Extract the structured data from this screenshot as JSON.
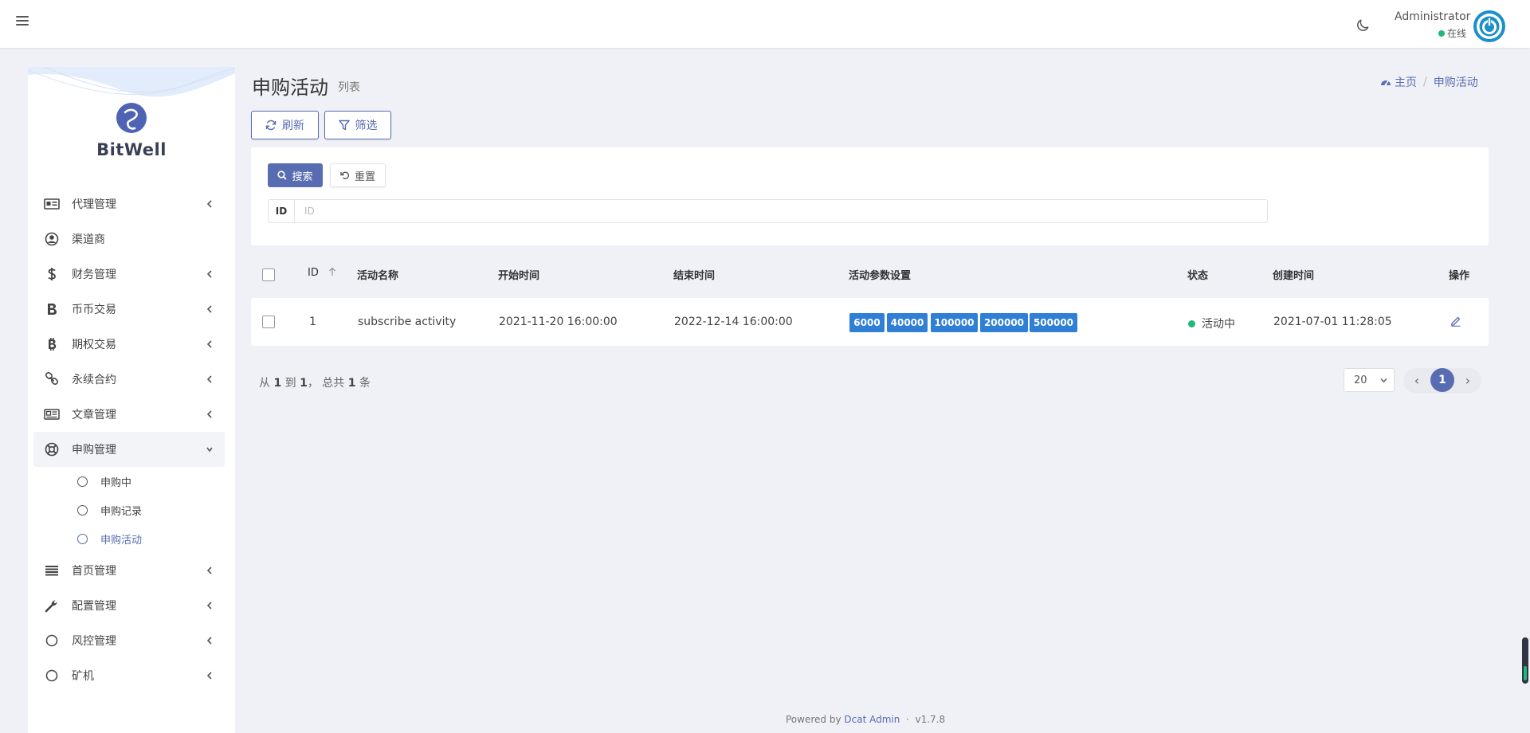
{
  "header": {
    "user_name": "Administrator",
    "user_status": "在线"
  },
  "sidebar": {
    "brand": "BitWell",
    "items": [
      {
        "label": "代理管理",
        "icon": "id-card-icon",
        "has_chevron": true
      },
      {
        "label": "渠道商",
        "icon": "user-circle-icon",
        "has_chevron": false
      },
      {
        "label": "财务管理",
        "icon": "dollar-icon",
        "has_chevron": true
      },
      {
        "label": "币币交易",
        "icon": "bold-b-icon",
        "has_chevron": true
      },
      {
        "label": "期权交易",
        "icon": "bitcoin-icon",
        "has_chevron": true
      },
      {
        "label": "永续合约",
        "icon": "link-icon",
        "has_chevron": true
      },
      {
        "label": "文章管理",
        "icon": "newspaper-icon",
        "has_chevron": true
      },
      {
        "label": "申购管理",
        "icon": "lifebuoy-icon",
        "has_chevron": true,
        "expanded": true
      },
      {
        "label": "首页管理",
        "icon": "list-icon",
        "has_chevron": true
      },
      {
        "label": "配置管理",
        "icon": "wrench-icon",
        "has_chevron": true
      },
      {
        "label": "风控管理",
        "icon": "circle-icon",
        "has_chevron": true
      },
      {
        "label": "矿机",
        "icon": "circle-icon",
        "has_chevron": true
      }
    ],
    "sub_items": [
      {
        "label": "申购中"
      },
      {
        "label": "申购记录"
      },
      {
        "label": "申购活动",
        "current": true
      }
    ]
  },
  "page": {
    "title": "申购活动",
    "subtitle": "列表",
    "breadcrumb": {
      "home": "主页",
      "current": "申购活动"
    }
  },
  "toolbar": {
    "refresh": "刷新",
    "filter": "筛选"
  },
  "filter": {
    "search": "搜索",
    "reset": "重置",
    "id_label": "ID",
    "id_placeholder": "ID",
    "id_value": ""
  },
  "table": {
    "headers": {
      "id": "ID",
      "name": "活动名称",
      "start": "开始时间",
      "end": "结束时间",
      "params": "活动参数设置",
      "status": "状态",
      "created": "创建时间",
      "actions": "操作"
    },
    "rows": [
      {
        "id": "1",
        "name": "subscribe activity",
        "start": "2021-11-20 16:00:00",
        "end": "2022-12-14 16:00:00",
        "params": [
          "6000",
          "40000",
          "100000",
          "200000",
          "500000"
        ],
        "status": "活动中",
        "created": "2021-07-01 11:28:05"
      }
    ]
  },
  "pagination": {
    "info_prefix": "从",
    "from": "1",
    "info_to": "到",
    "to": "1",
    "info_total": "， 总共",
    "total": "1",
    "info_suffix": "条",
    "per_page": "20",
    "current": "1",
    "prev": "‹",
    "next": "›"
  },
  "footer": {
    "powered_by": "Powered by",
    "link": "Dcat Admin",
    "sep": "·",
    "version": "v1.7.8"
  },
  "colors": {
    "primary": "#586cb1",
    "badge": "#2f7fd6",
    "online": "#21b978",
    "background": "#eff1f6"
  }
}
